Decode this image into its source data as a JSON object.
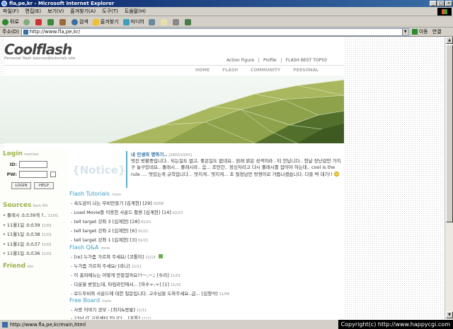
{
  "window": {
    "title": "fla,pe,kr - Microsoft Internet Explorer",
    "controls": {
      "minimize": "_",
      "maximize": "□",
      "close": "×"
    }
  },
  "menu": [
    "파일(F)",
    "편집(E)",
    "보기(V)",
    "즐겨찾기(A)",
    "도구(T)",
    "도움말(H)"
  ],
  "toolbar": {
    "back": "뒤로",
    "search": "검색",
    "favorites": "즐겨찾기",
    "media": "미디어"
  },
  "address": {
    "label": "주소(D)",
    "url": "http://www.fla,pe,kr/",
    "go": "이동",
    "links": "연결"
  },
  "site": {
    "logo": "Coolflash",
    "logo_sub": "Personal flash sources&tutorials site",
    "top_nav": [
      "Action Figure",
      "Profile",
      "FLASH BEST TOP50"
    ],
    "main_nav": [
      "HOME",
      "FLASH",
      "COMMUNITY",
      "PERSONAL"
    ],
    "login": {
      "title": "Login",
      "subtitle": "member",
      "id_label": "ID:",
      "pw_label": "PW:",
      "login_button": "LOGIN",
      "help_button": "HELP"
    },
    "sources": {
      "title": "Sources",
      "subtitle": "flash MX",
      "items": [
        {
          "text": "• 졸래시 소스39개 ?..",
          "date": "11/01"
        },
        {
          "text": "• 11월1일 소스39",
          "date": "11/01"
        },
        {
          "text": "• 11월1일 소스38",
          "date": "11/01"
        },
        {
          "text": "• 11월1일 소스37",
          "date": "11/01"
        },
        {
          "text": "• 11월1일 소스36",
          "date": "11/01"
        }
      ]
    },
    "friend": {
      "title": "Friend",
      "subtitle": "site"
    },
    "notice": {
      "label": "{Notice}",
      "title": "내 인생의 명하기..",
      "date": "[2002/10/01]",
      "body": "멋진 방황중입니다.. 되는일도 없고, 좋은일도 없네요.. 원래 밝은 성격이라.. 티 안납니다.. 현날 장난감만 가지구 놀구있네요.. 졸래시... 졸래시라.. 음... 조만간.. 정신차리고 다시 졸래시를 잡아야 하는데.. cool is the rule .... 멋있는게 규칙입니다... 멋지게.. 멋지게... 초 절정남만 멋쟁이로 거듭나겠습니다. 다들 딱 대기!!"
    },
    "flash_tutorials": {
      "title": "Flash Tutorials",
      "more": "more",
      "items": [
        {
          "text": "- 속도감이 나는 무비만들기 [김계현] [29]",
          "date": "03/06"
        },
        {
          "text": "- Load Movie를 이용한 사운드 활용 [김계현] [14]",
          "date": "02/23"
        },
        {
          "text": "- tell target 강좌 3 [김계현] [28]",
          "date": "01/21"
        },
        {
          "text": "- tell target 강좌 2 [김계현] [6]",
          "date": "01/21"
        },
        {
          "text": "- tell target 강좌 1 [김계현] [3]",
          "date": "01/21"
        }
      ]
    },
    "flash_qa": {
      "title": "Flash Q&A",
      "more": "more",
      "items": [
        {
          "text": "- [re] 누가좀 가르쳐 주세요/ [코톨이]",
          "date": "11/13",
          "new": true
        },
        {
          "text": "- 누가좀 가르쳐 주세요/ [라니]",
          "date": "11/11"
        },
        {
          "text": "- 이 홈피메뉴는 어떻게 만들껄까요??ㅡ,ㅡ;; [수리]",
          "date": "11/01"
        },
        {
          "text": "- 다운을 받았는데, 타임라인에서... [하수ㅜ,ㅜ] [1]",
          "date": "11/10"
        },
        {
          "text": "- 로드무비와 사운드에 대한 질문입니다. 고수님들 도와주세요..급... [김형석]",
          "date": "11/09"
        }
      ]
    },
    "free_board": {
      "title": "Free Board",
      "more": "more",
      "items": [
        {
          "text": "- 사랑 이야기 공모 - [최지&몽룡]",
          "date": "11/11"
        },
        {
          "text": "- 23남 IT 교육센터 입니다... [포틀]",
          "date": "11/11"
        }
      ]
    }
  },
  "status": {
    "url": "http://www.fla,pe,kr/main,html",
    "copyright": "Copyright(c) http://www.happycgi.com"
  }
}
